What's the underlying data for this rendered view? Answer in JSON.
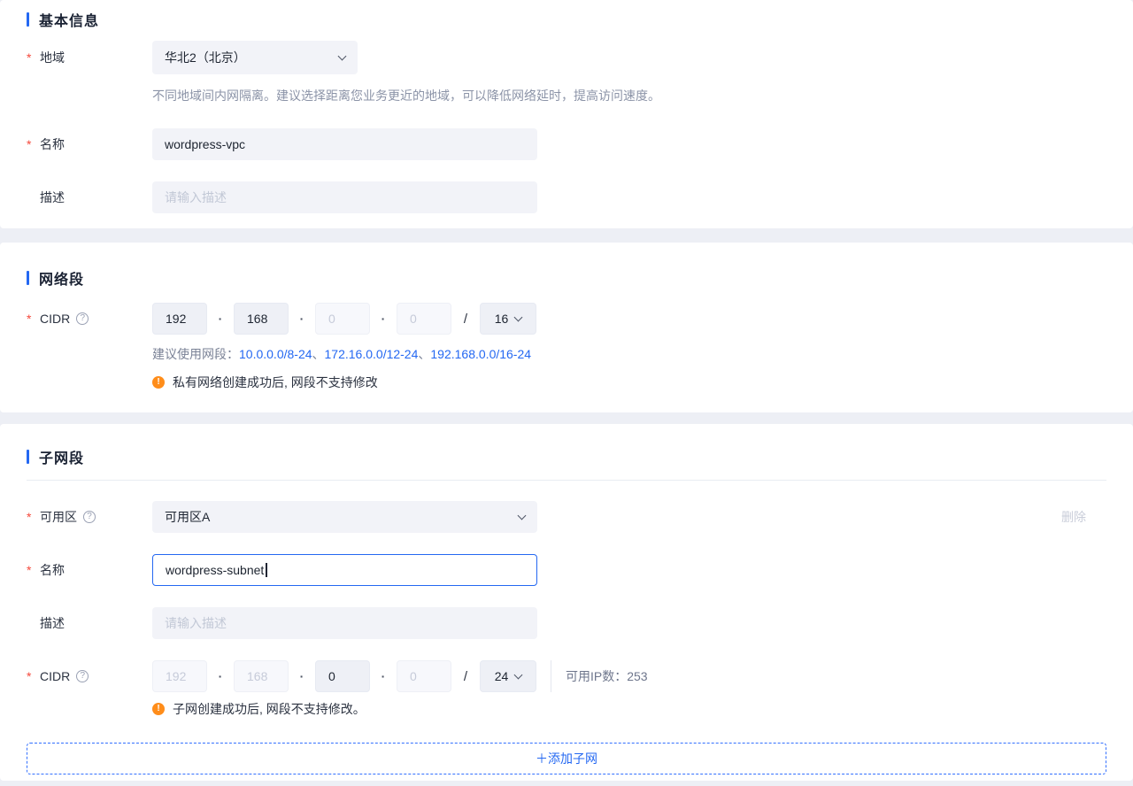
{
  "colors": {
    "accent_blue": "#2468f2",
    "link_blue": "#2468f2",
    "warning_orange": "#ff8d1a",
    "required_red": "#f5483b",
    "disabled_grey": "#c9cdd9"
  },
  "basic_info": {
    "title": "基本信息",
    "region": {
      "label": "地域",
      "value": "华北2（北京）",
      "help_text": "不同地域间内网隔离。建议选择距离您业务更近的地域，可以降低网络延时，提高访问速度。"
    },
    "name": {
      "label": "名称",
      "value": "wordpress-vpc"
    },
    "description": {
      "label": "描述",
      "placeholder": "请输入描述"
    }
  },
  "network_segment": {
    "title": "网络段",
    "cidr": {
      "label": "CIDR",
      "octets": [
        "192",
        "168",
        "0",
        "0"
      ],
      "dot": "·",
      "slash": "/",
      "mask": "16"
    },
    "suggestion": {
      "prefix": "建议使用网段：",
      "links": [
        "10.0.0.0/8-24",
        "172.16.0.0/12-24",
        "192.168.0.0/16-24"
      ],
      "separator": "、"
    },
    "warning_icon": "!",
    "warning": "私有网络创建成功后, 网段不支持修改"
  },
  "subnet_segment": {
    "title": "子网段",
    "zone": {
      "label": "可用区",
      "value": "可用区A"
    },
    "delete_label": "删除",
    "name": {
      "label": "名称",
      "value": "wordpress-subnet"
    },
    "description": {
      "label": "描述",
      "placeholder": "请输入描述"
    },
    "cidr": {
      "label": "CIDR",
      "octets": [
        "192",
        "168",
        "0",
        "0"
      ],
      "dot": "·",
      "slash": "/",
      "mask": "24",
      "available_ip_label": "可用IP数：",
      "available_ip_count": "253"
    },
    "warning_icon": "!",
    "warning": "子网创建成功后, 网段不支持修改。",
    "add_subnet_label": "＋添加子网"
  },
  "misc": {
    "required_mark": "*",
    "help_mark": "?"
  }
}
